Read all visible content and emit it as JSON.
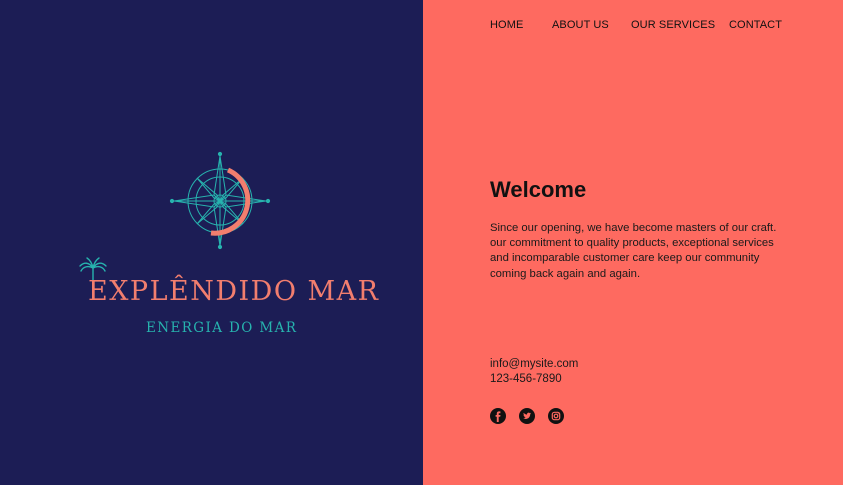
{
  "brand": {
    "name": "EXPLÊNDIDO MAR",
    "tagline": "ENERGIA DO MAR",
    "colors": {
      "left_background": "#1c1d55",
      "right_background": "#fe6a60",
      "brand_coral": "#f27e6e",
      "brand_teal": "#27b3ae"
    },
    "icons": [
      "compass-icon",
      "palm-tree-icon"
    ]
  },
  "nav": {
    "items": [
      {
        "label": "HOME"
      },
      {
        "label": "ABOUT US"
      },
      {
        "label": "OUR SERVICES"
      },
      {
        "label": "CONTACT"
      }
    ]
  },
  "welcome": {
    "title": "Welcome",
    "body_lines": [
      "Since our opening, we have become masters of our craft.",
      "our commitment to quality products, exceptional services",
      "and incomparable customer care keep our community",
      "coming back again and again."
    ]
  },
  "contact": {
    "email": "info@mysite.com",
    "phone": "123-456-7890"
  },
  "social": {
    "icons": [
      "facebook-icon",
      "twitter-icon",
      "instagram-icon"
    ]
  }
}
